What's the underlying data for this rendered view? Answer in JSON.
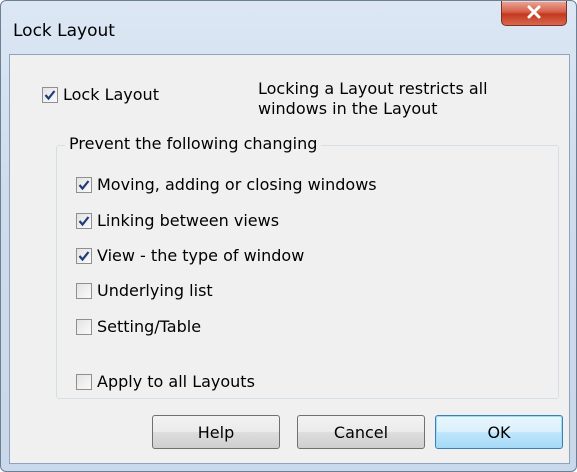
{
  "window": {
    "title": "Lock Layout",
    "close_glyph": "X"
  },
  "lock_layout": {
    "label": "Lock Layout",
    "checked": true,
    "description_line1": "Locking a Layout restricts all",
    "description_line2": "windows in the Layout"
  },
  "prevent_group": {
    "legend": "Prevent the following changing",
    "options": [
      {
        "label": "Moving, adding or closing windows",
        "checked": true
      },
      {
        "label": "Linking between views",
        "checked": true
      },
      {
        "label": "View - the type of window",
        "checked": true
      },
      {
        "label": "Underlying list",
        "checked": false
      },
      {
        "label": "Setting/Table",
        "checked": false
      }
    ]
  },
  "apply_all": {
    "label": "Apply to all Layouts",
    "checked": false
  },
  "buttons": {
    "help": "Help",
    "cancel": "Cancel",
    "ok": "OK"
  },
  "colors": {
    "checkmark": "#1f3c78",
    "close_button": "#c4391e",
    "ok_border": "#3c7fb1"
  }
}
